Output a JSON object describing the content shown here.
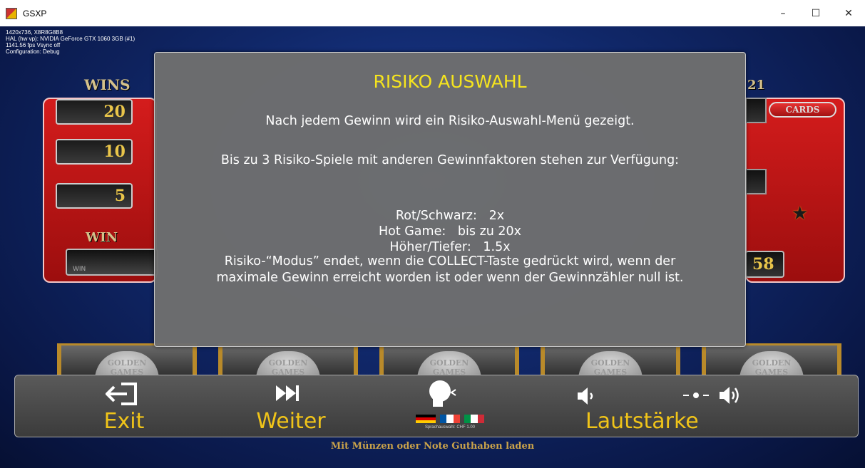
{
  "window": {
    "title": "GSXP",
    "controls": {
      "minimize": "–",
      "maximize": "☐",
      "close": "✕"
    }
  },
  "debug": {
    "lines": [
      "1420x736, X8R8G8B8",
      "HAL (hw vp): NVIDIA GeForce GTX 1060 3GB (#1)",
      "1141.56 fps  Vsync off",
      "Configuration: Debug"
    ]
  },
  "background": {
    "wins_label": "WINS",
    "stakes": [
      "20",
      "10",
      "5"
    ],
    "win_label": "WIN",
    "win_field_label": "WIN",
    "right_top_number": "21",
    "cards_label": "CARDS",
    "right_number": "58",
    "reel_label": "GOLDEN GAMES"
  },
  "modal": {
    "title": "RISIKO AUSWAHL",
    "line1": "Nach jedem Gewinn wird ein Risiko-Auswahl-Menü gezeigt.",
    "line2": "Bis zu 3 Risiko-Spiele mit anderen Gewinnfaktoren stehen zur Verfügung:",
    "options": [
      "Rot/Schwarz:   2x",
      "Hot Game:   bis zu 20x",
      "Höher/Tiefer:   1.5x"
    ],
    "note_line1": "Risiko-“Modus” endet, wenn die COLLECT-Taste gedrückt wird, wenn der",
    "note_line2": "maximale Gewinn erreicht worden ist oder wenn der Gewinnzähler null ist."
  },
  "bottombar": {
    "exit_label": "Exit",
    "next_label": "Weiter",
    "volume_label": "Lautstärke",
    "language_caption": "Sprachauswahl: CHF 1.00"
  },
  "footer": "Mit Münzen oder Note Guthaben laden",
  "colors": {
    "accent_yellow": "#f0c419",
    "modal_title": "#f5e41e",
    "modal_bg": "#6e6e6e"
  }
}
